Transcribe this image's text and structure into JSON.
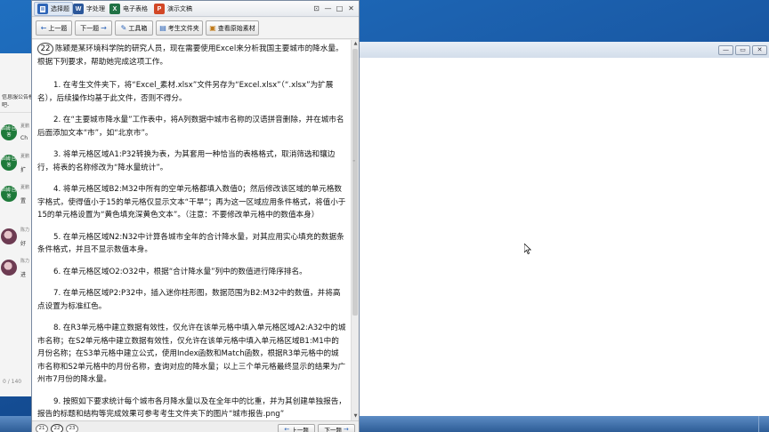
{
  "app_tabs": [
    {
      "label": "选择题",
      "icon": "document-icon",
      "icon_text": "",
      "color": "#2f66b8"
    },
    {
      "label": "字处理",
      "icon": "word-icon",
      "icon_text": "W",
      "color": "#2b579a"
    },
    {
      "label": "电子表格",
      "icon": "excel-icon",
      "icon_text": "X",
      "color": "#217346"
    },
    {
      "label": "演示文稿",
      "icon": "powerpoint-icon",
      "icon_text": "P",
      "color": "#d24726"
    }
  ],
  "window_controls": {
    "pin": "⊡",
    "minimize": "—",
    "maximize": "□",
    "close": "✕"
  },
  "toolbar": {
    "prev": "上一题",
    "next": "下一题",
    "toolbox": "工具箱",
    "exam_folder": "考生文件夹",
    "view_original": "查看原始素材"
  },
  "question": {
    "number": "22",
    "intro": "陈颖是某环境科学院的研究人员，现在需要使用Excel来分析我国主要城市的降水量。根据下列要求，帮助她完成这项工作。",
    "items": [
      "1. 在考生文件夹下，将“Excel_素材.xlsx”文件另存为“Excel.xlsx”（“.xlsx”为扩展名），后续操作均基于此文件，否则不得分。",
      "2. 在“主要城市降水量”工作表中，将A列数据中城市名称的汉语拼音删除，并在城市名后面添加文本“市”，如“北京市”。",
      "3. 将单元格区域A1:P32转换为表，为其套用一种恰当的表格格式，取消筛选和镶边行，将表的名称修改为“降水量统计”。",
      "4. 将单元格区域B2:M32中所有的空单元格都填入数值0；然后修改该区域的单元格数字格式，使得值小于15的单元格仅显示文本“干旱”；再为这一区域应用条件格式，将值小于15的单元格设置为“黄色填充深黄色文本”。（注意：不要修改单元格中的数值本身）",
      "5. 在单元格区域N2:N32中计算各城市全年的合计降水量，对其应用实心填充的数据条条件格式，并且不显示数值本身。",
      "6. 在单元格区域O2:O32中，根据“合计降水量”列中的数值进行降序排名。",
      "7. 在单元格区域P2:P32中，插入迷你柱形图，数据范围为B2:M32中的数值，并将高点设置为标准红色。",
      "8. 在R3单元格中建立数据有效性，仅允许在该单元格中填入单元格区域A2:A32中的城市名称；在S2单元格中建立数据有效性，仅允许在该单元格中填入单元格区域B1:M1中的月份名称；在S3单元格中建立公式，使用Index函数和Match函数，根据R3单元格中的城市名称和S2单元格中的月份名称，查询对应的降水量；以上三个单元格最终显示的结果为广州市7月份的降水量。",
      "9. 按照如下要求统计每个城市各月降水量以及在全年中的比重，并为其创建单独报告，报告的标题和结构等完成效果可参考考生文件夹下的图片“城市报告.png”"
    ]
  },
  "bottom_nav": {
    "question_numbers": [
      "21",
      "22",
      "23"
    ],
    "current": "22",
    "prev": "上一题",
    "next": "下一题"
  },
  "background_chat": {
    "header_text": "信息服公告模",
    "header_text2": "吧-",
    "contacts": [
      {
        "badge": "四姆\n回答",
        "name": "夏鹏",
        "snippet": "Ch"
      },
      {
        "badge": "四姆\n回答",
        "name": "夏鹏",
        "snippet": "扩"
      },
      {
        "badge": "四姆\n回答",
        "name": "夏鹏",
        "snippet": "置"
      },
      {
        "badge": "",
        "name": "陈力",
        "snippet": "好"
      },
      {
        "badge": "",
        "name": "陈力",
        "snippet": "进"
      }
    ],
    "char_count": "0 / 140"
  },
  "background_window": {
    "controls": {
      "minimize": "—",
      "maximize": "▭",
      "close": "✕"
    }
  },
  "colors": {
    "accent": "#2a63b8",
    "chat_badge": "#1e7a3a",
    "desktop": "#1a5aa6"
  }
}
